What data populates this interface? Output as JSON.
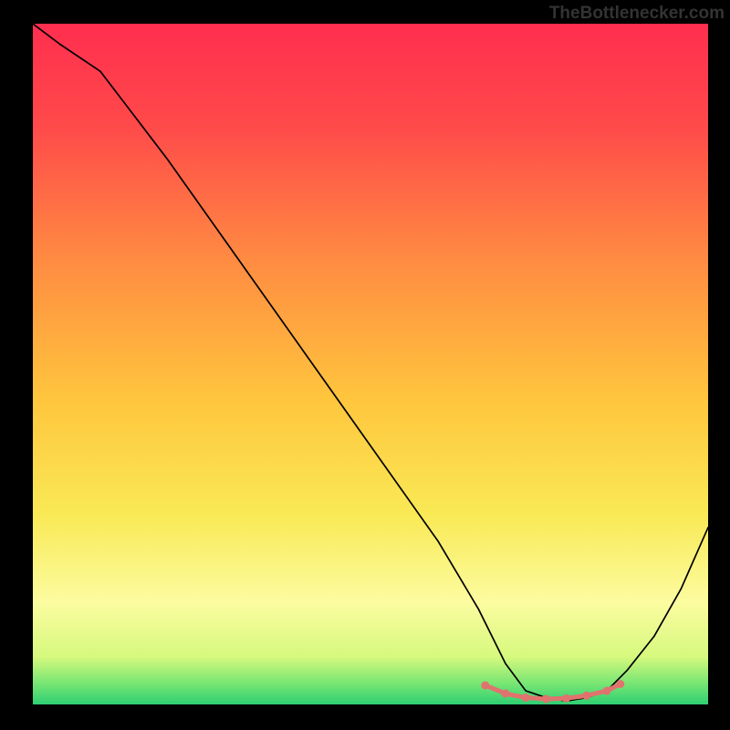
{
  "watermark": "TheBottlenecker.com",
  "chart_data": {
    "type": "line",
    "title": "",
    "xlabel": "",
    "ylabel": "",
    "xlim": [
      0,
      100
    ],
    "ylim": [
      0,
      100
    ],
    "series": [
      {
        "name": "bottleneck-curve",
        "x": [
          0,
          4,
          10,
          20,
          30,
          40,
          50,
          60,
          66,
          70,
          73,
          76,
          79,
          82,
          85,
          88,
          92,
          96,
          100
        ],
        "y": [
          100,
          97,
          93,
          80,
          66,
          52,
          38,
          24,
          14,
          6,
          2,
          1,
          0.5,
          1,
          2,
          5,
          10,
          17,
          26
        ],
        "color": "#000000",
        "width": 1.7
      },
      {
        "name": "optimal-segment",
        "x": [
          67,
          70,
          73,
          76,
          79,
          82,
          85,
          87
        ],
        "y": [
          2.8,
          1.6,
          1.0,
          0.8,
          0.9,
          1.3,
          2.0,
          3.0
        ],
        "color": "#E0736E",
        "width": 7,
        "dotted": true
      }
    ],
    "background_gradient": [
      {
        "offset": 0.0,
        "color": "#FF2E4F"
      },
      {
        "offset": 0.15,
        "color": "#FF4A4A"
      },
      {
        "offset": 0.35,
        "color": "#FF8C42"
      },
      {
        "offset": 0.55,
        "color": "#FFC53D"
      },
      {
        "offset": 0.72,
        "color": "#F9E955"
      },
      {
        "offset": 0.85,
        "color": "#FCFCA0"
      },
      {
        "offset": 0.93,
        "color": "#D6F97E"
      },
      {
        "offset": 0.97,
        "color": "#76E573"
      },
      {
        "offset": 1.0,
        "color": "#2ECF73"
      }
    ]
  }
}
